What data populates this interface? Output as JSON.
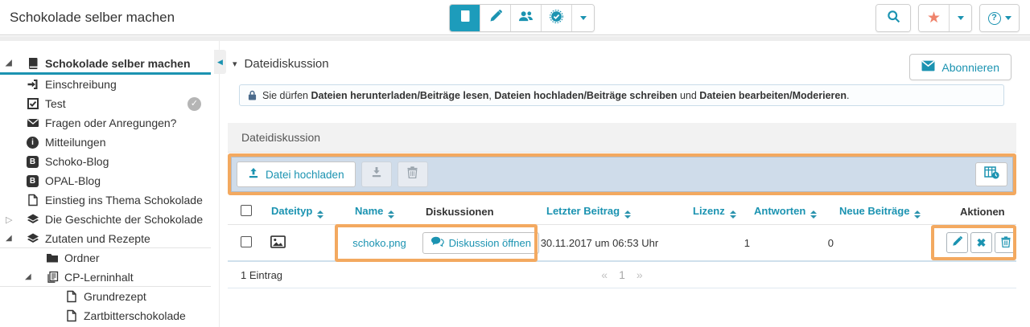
{
  "colors": {
    "accent": "#1b93b1",
    "active_tool_bg": "#1d9cbb",
    "highlight_border": "#f3a960",
    "star": "#ef836c",
    "toolbar_bg": "#cfdcea",
    "row_border": "#cfe0ec"
  },
  "header": {
    "title": "Schokolade selber machen",
    "center_tools": [
      "course-book",
      "edit-pencil",
      "members",
      "assessment-badge",
      "more-dropdown"
    ],
    "right_tools": [
      "search",
      "bookmark-star",
      "bookmark-dropdown",
      "help",
      "help-dropdown"
    ]
  },
  "sidebar": {
    "items": [
      {
        "label": "Schokolade selber machen",
        "icon": "book",
        "level": 0,
        "selected": true,
        "expanded": true
      },
      {
        "label": "Einschreibung",
        "icon": "sign-in",
        "level": 1
      },
      {
        "label": "Test",
        "icon": "checkbox",
        "level": 1,
        "badge": "completed"
      },
      {
        "label": "Fragen oder Anregungen?",
        "icon": "envelope",
        "level": 1
      },
      {
        "label": "Mitteilungen",
        "icon": "info",
        "level": 1
      },
      {
        "label": "Schoko-Blog",
        "icon": "blog",
        "level": 1
      },
      {
        "label": "OPAL-Blog",
        "icon": "blog",
        "level": 1
      },
      {
        "label": "Einstieg ins Thema Schokolade",
        "icon": "page",
        "level": 1
      },
      {
        "label": "Die Geschichte der Schokolade",
        "icon": "layers",
        "level": 1,
        "collapsed": true
      },
      {
        "label": "Zutaten und Rezepte",
        "icon": "layers",
        "level": 1,
        "expanded": true
      },
      {
        "label": "Ordner",
        "icon": "folder",
        "level": 2
      },
      {
        "label": "CP-Lerninhalt",
        "icon": "content-package",
        "level": 2,
        "expanded": true
      },
      {
        "label": "Grundrezept",
        "icon": "page",
        "level": 3
      },
      {
        "label": "Zartbitterschokolade",
        "icon": "page",
        "level": 3
      }
    ]
  },
  "main": {
    "section_title": "Dateidiskussion",
    "subscribe_label": "Abonnieren",
    "permission_notice": {
      "prefix": "Sie dürfen ",
      "bold1": "Dateien herunterladen/Beiträge lesen",
      "sep1": ", ",
      "bold2": "Dateien hochladen/Beiträge schreiben",
      "sep2": " und ",
      "bold3": "Dateien bearbeiten/Moderieren",
      "suffix": "."
    },
    "panel_title": "Dateidiskussion",
    "toolbar": {
      "upload_label": "Datei hochladen",
      "disabled_tools": [
        "download",
        "delete"
      ],
      "right_tool": "table-settings"
    },
    "table": {
      "columns": [
        {
          "label": "Dateityp",
          "sortable": true
        },
        {
          "label": "Name",
          "sortable": true
        },
        {
          "label": "Diskussionen",
          "sortable": false
        },
        {
          "label": "Letzter Beitrag",
          "sortable": true
        },
        {
          "label": "Lizenz",
          "sortable": true
        },
        {
          "label": "Antworten",
          "sortable": true
        },
        {
          "label": "Neue Beiträge",
          "sortable": true
        },
        {
          "label": "Aktionen",
          "sortable": false
        }
      ],
      "rows": [
        {
          "file_type_icon": "image-file",
          "name": "schoko.png",
          "discussion_button": "Diskussion öffnen",
          "last_post": "30.11.2017 um 06:53 Uhr",
          "license": "",
          "answers": "1",
          "new_posts": "0",
          "actions": [
            "edit",
            "asterisk",
            "delete"
          ]
        }
      ],
      "footer": {
        "count": "1 Eintrag",
        "pagination": {
          "prev": "«",
          "page": "1",
          "next": "»"
        }
      }
    }
  }
}
